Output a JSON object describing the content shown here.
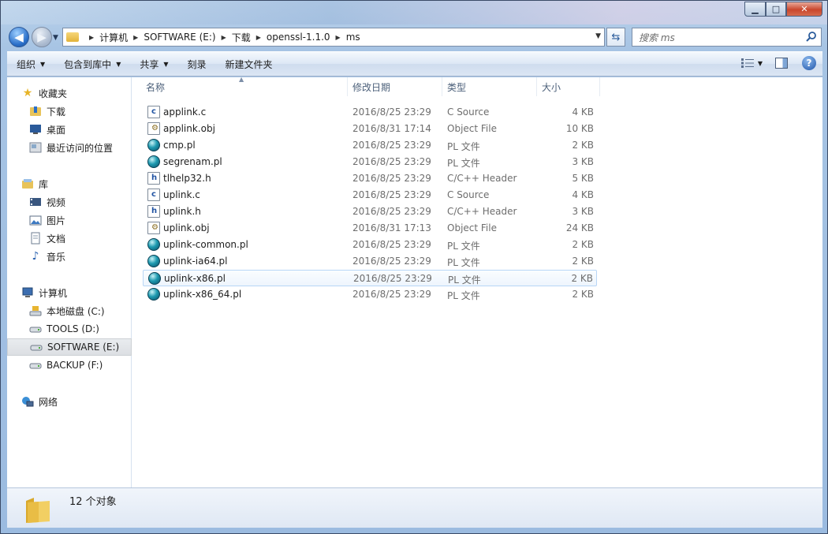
{
  "window": {
    "controls": {
      "minimize": "▁",
      "maximize": "□",
      "close": "✕"
    }
  },
  "nav": {
    "breadcrumbs": [
      "计算机",
      "SOFTWARE (E:)",
      "下载",
      "openssl-1.1.0",
      "ms"
    ],
    "search_placeholder": "搜索 ms"
  },
  "toolbar": {
    "items": [
      "组织",
      "包含到库中",
      "共享",
      "刻录",
      "新建文件夹"
    ]
  },
  "sidebar": {
    "favorites": {
      "label": "收藏夹",
      "items": [
        "下载",
        "桌面",
        "最近访问的位置"
      ]
    },
    "libraries": {
      "label": "库",
      "items": [
        "视频",
        "图片",
        "文档",
        "音乐"
      ]
    },
    "computer": {
      "label": "计算机",
      "items": [
        "本地磁盘 (C:)",
        "TOOLS (D:)",
        "SOFTWARE (E:)",
        "BACKUP (F:)"
      ],
      "selected": "SOFTWARE (E:)"
    },
    "network": {
      "label": "网络"
    }
  },
  "columns": {
    "name": "名称",
    "date": "修改日期",
    "type": "类型",
    "size": "大小"
  },
  "files": [
    {
      "name": "applink.c",
      "date": "2016/8/25 23:29",
      "type": "C Source",
      "size": "4 KB",
      "icon": "c-source-icon"
    },
    {
      "name": "applink.obj",
      "date": "2016/8/31 17:14",
      "type": "Object File",
      "size": "10 KB",
      "icon": "object-file-icon"
    },
    {
      "name": "cmp.pl",
      "date": "2016/8/25 23:29",
      "type": "PL 文件",
      "size": "2 KB",
      "icon": "perl-file-icon"
    },
    {
      "name": "segrenam.pl",
      "date": "2016/8/25 23:29",
      "type": "PL 文件",
      "size": "3 KB",
      "icon": "perl-file-icon"
    },
    {
      "name": "tlhelp32.h",
      "date": "2016/8/25 23:29",
      "type": "C/C++ Header",
      "size": "5 KB",
      "icon": "header-file-icon"
    },
    {
      "name": "uplink.c",
      "date": "2016/8/25 23:29",
      "type": "C Source",
      "size": "4 KB",
      "icon": "c-source-icon"
    },
    {
      "name": "uplink.h",
      "date": "2016/8/25 23:29",
      "type": "C/C++ Header",
      "size": "3 KB",
      "icon": "header-file-icon"
    },
    {
      "name": "uplink.obj",
      "date": "2016/8/31 17:13",
      "type": "Object File",
      "size": "24 KB",
      "icon": "object-file-icon"
    },
    {
      "name": "uplink-common.pl",
      "date": "2016/8/25 23:29",
      "type": "PL 文件",
      "size": "2 KB",
      "icon": "perl-file-icon"
    },
    {
      "name": "uplink-ia64.pl",
      "date": "2016/8/25 23:29",
      "type": "PL 文件",
      "size": "2 KB",
      "icon": "perl-file-icon"
    },
    {
      "name": "uplink-x86.pl",
      "date": "2016/8/25 23:29",
      "type": "PL 文件",
      "size": "2 KB",
      "icon": "perl-file-icon"
    },
    {
      "name": "uplink-x86_64.pl",
      "date": "2016/8/25 23:29",
      "type": "PL 文件",
      "size": "2 KB",
      "icon": "perl-file-icon"
    }
  ],
  "status": {
    "text": "12 个对象"
  }
}
